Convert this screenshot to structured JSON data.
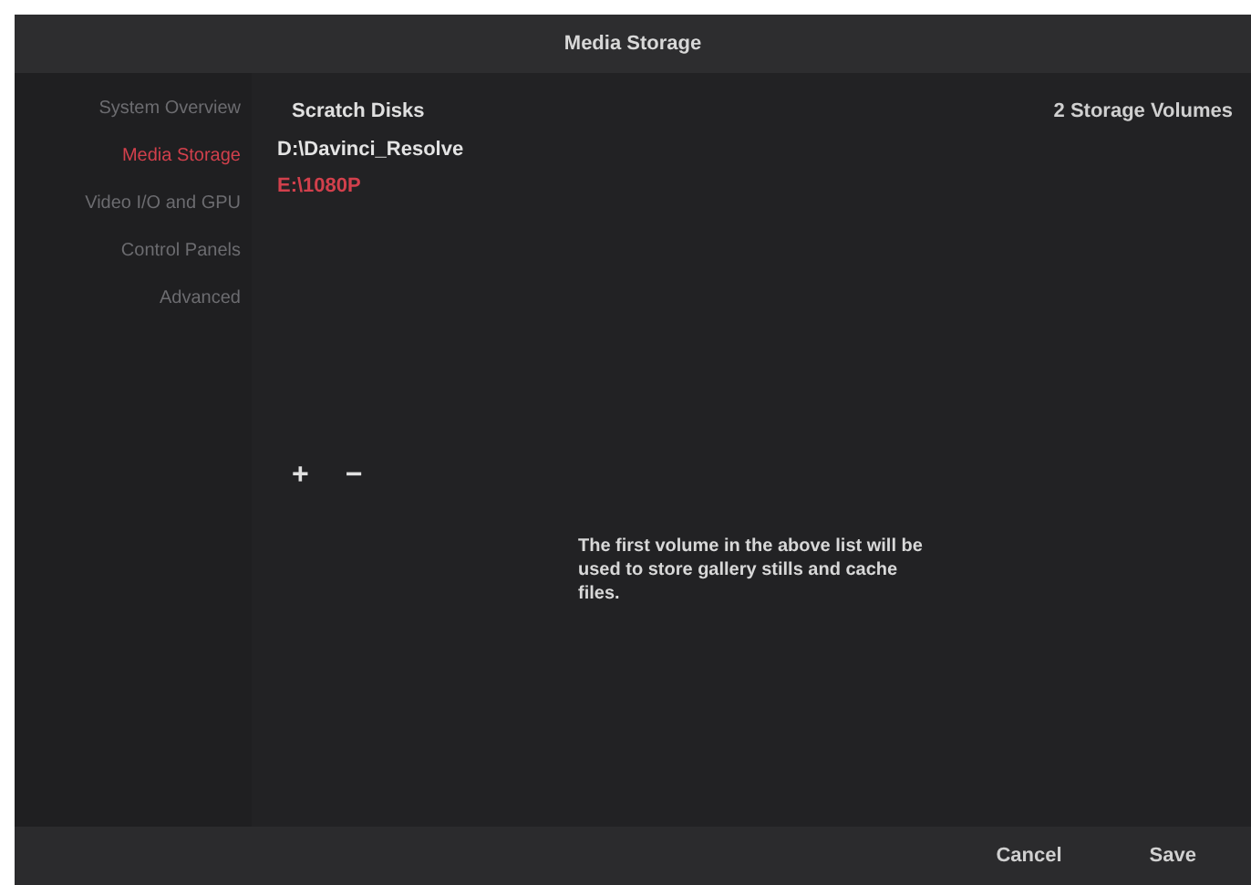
{
  "window": {
    "title": "Media Storage"
  },
  "sidebar": {
    "items": [
      {
        "label": "System Overview",
        "selected": false
      },
      {
        "label": "Media Storage",
        "selected": true
      },
      {
        "label": "Video I/O and GPU",
        "selected": false
      },
      {
        "label": "Control Panels",
        "selected": false
      },
      {
        "label": "Advanced",
        "selected": false
      }
    ]
  },
  "scratch_disks": {
    "heading": "Scratch Disks",
    "count": "2 Storage Volumes",
    "volumes": [
      {
        "path": "D:\\Davinci_Resolve",
        "selected": false
      },
      {
        "path": "E:\\1080P",
        "selected": true
      }
    ],
    "add": "+",
    "remove": "−"
  },
  "note": "The first volume in the above list will be used to store gallery stills and cache files.",
  "buttons": [
    "Cancel",
    "Save"
  ]
}
